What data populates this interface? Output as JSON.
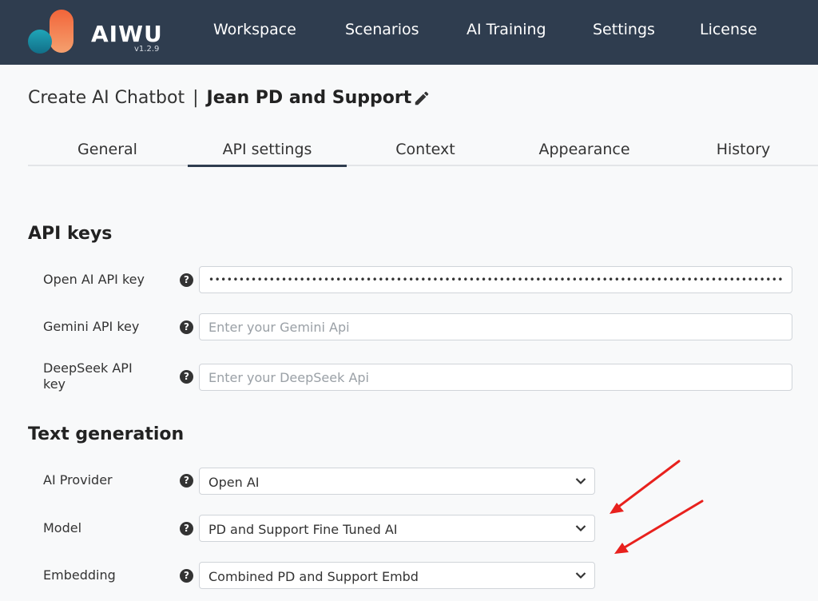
{
  "app": {
    "brand": "AIWU",
    "version": "v1.2.9"
  },
  "nav": {
    "items": [
      {
        "label": "Workspace"
      },
      {
        "label": "Scenarios"
      },
      {
        "label": "AI Training"
      },
      {
        "label": "Settings"
      },
      {
        "label": "License"
      }
    ]
  },
  "page": {
    "title_prefix": "Create AI Chatbot",
    "title_separator": "|",
    "bot_name": "Jean PD and Support"
  },
  "tabs": {
    "items": [
      {
        "label": "General"
      },
      {
        "label": "API settings",
        "active": true
      },
      {
        "label": "Context"
      },
      {
        "label": "Appearance"
      },
      {
        "label": "History"
      }
    ]
  },
  "api_keys": {
    "title": "API keys",
    "openai": {
      "label": "Open AI API key",
      "value": "••••••••••••••••••••••••••••••••••••••••••••••••••••••••••••••••••••••••••••••••••••••••••••••••••••"
    },
    "gemini": {
      "label": "Gemini API key",
      "placeholder": "Enter your Gemini Api",
      "value": ""
    },
    "deepseek": {
      "label": "DeepSeek API key",
      "placeholder": "Enter your DeepSeek Api",
      "value": ""
    }
  },
  "text_generation": {
    "title": "Text generation",
    "provider": {
      "label": "AI Provider",
      "value": "Open AI"
    },
    "model": {
      "label": "Model",
      "value": "PD and Support Fine Tuned AI"
    },
    "embedding": {
      "label": "Embedding",
      "value": "Combined PD and Support Embd"
    }
  },
  "help_glyph": "?",
  "colors": {
    "topbar": "#2f3d4f",
    "background": "#f8f9fa",
    "annotation_arrow": "#e8211d",
    "logo_orange": "#f07a4a",
    "logo_teal": "#1b8fa3"
  },
  "icons": {
    "edit": "pencil-icon",
    "help": "question-circle-icon",
    "select": "chevron-down-icon"
  }
}
